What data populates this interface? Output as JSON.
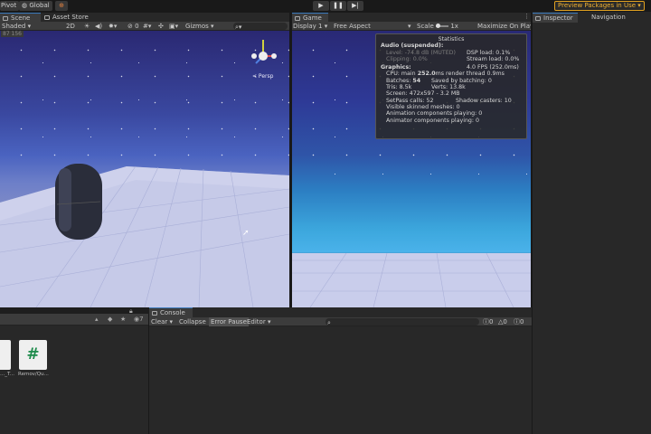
{
  "toolbar": {
    "pivot_label": "Pivot",
    "global_label": "Global",
    "preview_label": "Preview Packages in Use"
  },
  "scene_tabs": [
    {
      "label": "Scene"
    },
    {
      "label": "Asset Store"
    }
  ],
  "scene_bar": {
    "shading": "Shaded",
    "mode_2d": "2D",
    "gizmos": "Gizmos"
  },
  "scene_overlay": {
    "fps_hint": "87 156",
    "persp_label": "< Persp",
    "gizmo_axis": "x"
  },
  "game_tab": {
    "label": "Game"
  },
  "game_bar": {
    "display": "Display 1",
    "aspect": "Free Aspect",
    "scale_label": "Scale",
    "scale_value": "1x",
    "maximize": "Maximize On Play"
  },
  "stats": {
    "title": "Statistics",
    "audio_header": "Audio (suspended):",
    "level": "Level: -74.8 dB (MUTED)",
    "clipping": "Clipping: 0.0%",
    "dsp_load": "DSP load: 0.1%",
    "stream_load": "Stream load: 0.0%",
    "graphics_header": "Graphics:",
    "fps": "4.0 FPS (252.0ms)",
    "cpu_prefix": "CPU: main",
    "cpu_main": "252.0",
    "cpu_suffix": "ms  render thread 0.9ms",
    "batches_prefix": "Batches:",
    "batches": "54",
    "saved_batching": "Saved by batching: 0",
    "tris": "Tris: 8.5k",
    "verts": "Verts: 13.8k",
    "screen": "Screen: 472x597 - 3.2 MB",
    "setpass": "SetPass calls: 52",
    "shadow_casters": "Shadow casters: 10",
    "skinned": "Visible skinned meshes: 0",
    "anim_components": "Animation components playing: 0",
    "animator_components": "Animator components playing: 0"
  },
  "inspector_tabs": [
    {
      "label": "Inspector"
    },
    {
      "label": "Navigation"
    }
  ],
  "project": {
    "count": "7",
    "items": [
      {
        "label": "..._T..."
      },
      {
        "label": "Remov/Qu..."
      }
    ]
  },
  "console": {
    "tab_label": "Console",
    "clear": "Clear",
    "collapse": "Collapse",
    "error_pause": "Error Pause",
    "editor": "Editor",
    "count_a": "0",
    "count_b": "0",
    "count_c": "0"
  }
}
